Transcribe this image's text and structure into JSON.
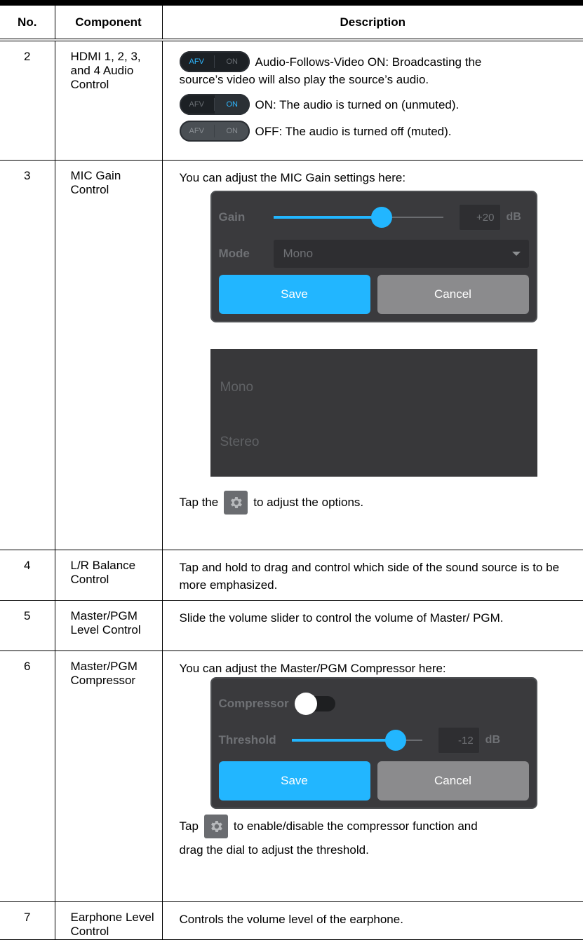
{
  "header": {
    "no": "No.",
    "component": "Component",
    "description": "Description"
  },
  "rows": {
    "r2": {
      "no": "2",
      "component": "HDMI 1, 2, 3, and 4 Audio Control",
      "afv_label": "AFV",
      "on_label": "ON",
      "line1a": "Audio-Follows-Video ON: Broadcasting the",
      "line1b": "source’s video will also play the source’s audio.",
      "line2": "ON: The audio is turned on (unmuted).",
      "line3": "OFF: The audio is turned off (muted)."
    },
    "r3": {
      "no": "3",
      "component": "MIC Gain Control",
      "intro": "You can adjust the MIC Gain settings here:",
      "panel": {
        "gain_label": "Gain",
        "gain_value": "+20",
        "gain_level": 0.64,
        "unit": "dB",
        "mode_label": "Mode",
        "mode_value": "Mono",
        "save": "Save",
        "cancel": "Cancel"
      },
      "options": [
        "Mono",
        "Stereo"
      ],
      "tap_a": "Tap the",
      "tap_b": "to adjust the options."
    },
    "r4": {
      "no": "4",
      "component": "L/R Balance Control",
      "description": "Tap and hold to drag and control which side of the sound source is to be more emphasized."
    },
    "r5": {
      "no": "5",
      "component": "Master/PGM Level Control",
      "description": "Slide the volume slider to control the volume of Master/ PGM."
    },
    "r6": {
      "no": "6",
      "component": "Master/PGM Compressor",
      "intro": "You can adjust the Master/PGM Compressor here:",
      "panel": {
        "compressor_label": "Compressor",
        "threshold_label": "Threshold",
        "threshold_value": "-12",
        "threshold_level": 0.8,
        "unit": "dB",
        "save": "Save",
        "cancel": "Cancel"
      },
      "tap_a": "Tap",
      "tap_b": "to enable/disable the compressor function and",
      "tap_c": "drag the dial to adjust the threshold."
    },
    "r7": {
      "no": "7",
      "component": "Earphone Level Control",
      "description": "Controls the volume level of the earphone."
    }
  },
  "colors": {
    "accent": "#22b6ff",
    "panel": "#3a3a3d"
  },
  "icons": {
    "settings": "gear-icon"
  }
}
